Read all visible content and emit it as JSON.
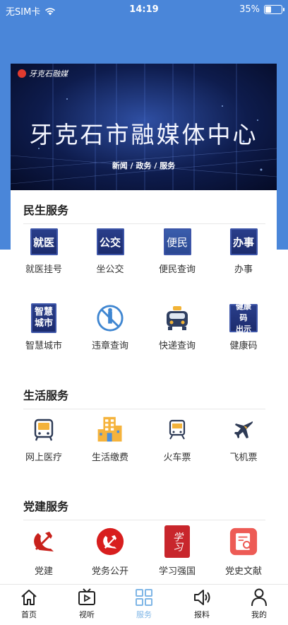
{
  "status": {
    "carrier": "无SIM卡",
    "time": "14:19",
    "battery": "35%",
    "battery_level": 0.35
  },
  "banner": {
    "logo_text": "牙克石融媒",
    "title": "牙克石市融媒体中心",
    "subtitle": "新闻 / 政务 / 服务"
  },
  "sections": {
    "minsheng": {
      "title": "民生服务",
      "items": [
        {
          "label": "就医挂号",
          "icon_text": "就医",
          "icon": "hospital-registration-icon"
        },
        {
          "label": "坐公交",
          "icon_text": "公交",
          "icon": "bus-icon"
        },
        {
          "label": "便民查询",
          "icon_text": "便民",
          "icon": "convenience-icon"
        },
        {
          "label": "办事",
          "icon_text": "办事",
          "icon": "affairs-icon"
        },
        {
          "label": "智慧城市",
          "icon_text": "智慧城市",
          "icon": "smart-city-icon"
        },
        {
          "label": "违章查询",
          "icon": "violation-icon"
        },
        {
          "label": "快递查询",
          "icon": "express-icon"
        },
        {
          "label": "健康码",
          "icon_text": "健康码出示",
          "icon": "health-code-icon"
        }
      ]
    },
    "shenghuo": {
      "title": "生活服务",
      "items": [
        {
          "label": "网上医疗",
          "icon": "online-medical-icon"
        },
        {
          "label": "生活缴费",
          "icon": "bill-payment-icon"
        },
        {
          "label": "火车票",
          "icon": "train-icon"
        },
        {
          "label": "飞机票",
          "icon": "plane-icon"
        }
      ]
    },
    "dangjian": {
      "title": "党建服务",
      "items": [
        {
          "label": "党建",
          "icon": "party-emblem-icon"
        },
        {
          "label": "党务公开",
          "icon": "party-affairs-icon"
        },
        {
          "label": "学习强国",
          "icon": "xuexi-icon",
          "icon_text": "学习"
        },
        {
          "label": "党史文献",
          "icon": "party-history-icon"
        }
      ]
    }
  },
  "tabs": [
    {
      "label": "首页",
      "icon": "home-icon"
    },
    {
      "label": "视听",
      "icon": "video-icon"
    },
    {
      "label": "服务",
      "icon": "services-icon",
      "active": true
    },
    {
      "label": "报料",
      "icon": "report-icon"
    },
    {
      "label": "我的",
      "icon": "profile-icon"
    }
  ],
  "colors": {
    "header_blue": "#4a86d9",
    "tab_active": "#7fb6e6",
    "party_red": "#c8211b",
    "navy": "#1b2a6b"
  }
}
